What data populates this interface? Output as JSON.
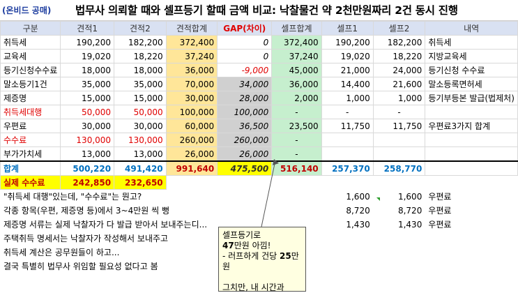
{
  "header": {
    "tag": "(온비드 공매)",
    "title": "법무사 의뢰할 때와 셀프등기 할때 금액 비교: 낙찰물건 약 2천만원짜리 2건 동시 진행"
  },
  "columns": [
    "구분",
    "견적1",
    "견적2",
    "견적합계",
    "GAP(차이)",
    "셀프합계",
    "셀프1",
    "셀프2",
    "내역"
  ],
  "rows": [
    {
      "label": "취득세",
      "e1": "190,200",
      "e2": "182,200",
      "esum": "372,400",
      "gap": "0",
      "ssum": "372,400",
      "s1": "190,200",
      "s2": "182,200",
      "memo": "취득세"
    },
    {
      "label": "교육세",
      "e1": "19,020",
      "e2": "18,220",
      "esum": "37,240",
      "gap": "0",
      "ssum": "37,240",
      "s1": "19,020",
      "s2": "18,220",
      "memo": "지방교육세"
    },
    {
      "label": "등기신청수수료",
      "e1": "18,000",
      "e2": "18,000",
      "esum": "36,000",
      "gap": "-9,000",
      "ssum": "45,000",
      "s1": "21,000",
      "s2": "24,000",
      "memo": "등기신청 수수료"
    },
    {
      "label": "말소등기1건",
      "e1": "35,000",
      "e2": "35,000",
      "esum": "70,000",
      "gap": "34,000",
      "ssum": "36,000",
      "s1": "14,400",
      "s2": "21,600",
      "memo": "말소등록면허세"
    },
    {
      "label": "제증명",
      "e1": "15,000",
      "e2": "15,000",
      "esum": "30,000",
      "gap": "28,000",
      "ssum": "2,000",
      "s1": "1,000",
      "s2": "1,000",
      "memo": "등기부등본 발급(법제처)"
    },
    {
      "label": "취득세대행",
      "e1": "50,000",
      "e2": "50,000",
      "esum": "100,000",
      "gap": "100,000",
      "ssum": "-",
      "s1": "-",
      "s2": "-",
      "memo": ""
    },
    {
      "label": "우편료",
      "e1": "30,000",
      "e2": "30,000",
      "esum": "60,000",
      "gap": "36,500",
      "ssum": "23,500",
      "s1": "11,750",
      "s2": "11,750",
      "memo": "우편료3가지 합계"
    },
    {
      "label": "수수료",
      "e1": "130,000",
      "e2": "130,000",
      "esum": "260,000",
      "gap": "260,000",
      "ssum": "-",
      "s1": "",
      "s2": "",
      "memo": ""
    },
    {
      "label": "부가가치세",
      "e1": "13,000",
      "e2": "13,000",
      "esum": "26,000",
      "gap": "26,000",
      "ssum": "-",
      "s1": "",
      "s2": "",
      "memo": ""
    }
  ],
  "total": {
    "label": "합계",
    "e1": "500,220",
    "e2": "491,420",
    "esum": "991,640",
    "gap": "475,500",
    "ssum": "516,140",
    "s1": "257,370",
    "s2": "258,770"
  },
  "actual": {
    "label": "실제 수수료",
    "e1": "242,850",
    "e2": "232,650"
  },
  "notes": [
    {
      "text": "\"취득세 대행\"있는데, \"수수료\"는 뭔고?",
      "s1": "1,600",
      "s2": "1,600",
      "memo": "우편료"
    },
    {
      "text": "각종 항목(우편, 제증명 등)에서 3~4만원 씩 뻥",
      "s1": "8,720",
      "s2": "8,720",
      "memo": "우편료"
    },
    {
      "text": "제증명 서류는 실제 낙찰자가 다 발급 받아서 보내주는디...",
      "s1": "1,430",
      "s2": "1,430",
      "memo": "우편료"
    },
    {
      "text": "주택취득 명세서는 낙찰자가 작성해서 보내주고",
      "s1": "",
      "s2": "",
      "memo": ""
    },
    {
      "text": "취득세 계산은 공무원들이 하고...",
      "s1": "",
      "s2": "",
      "memo": ""
    },
    {
      "text": "결국 특별히 법무사 위임할 필요성 없다고 봄",
      "s1": "",
      "s2": "",
      "memo": ""
    }
  ],
  "comment": {
    "line1": "셀프등기로",
    "line2_bold": "47",
    "line2_rest": "만원 아낌!",
    "line3_pre": " - 러프하게 건당 ",
    "line3_bold": "25",
    "line3_post": "만원",
    "line4": "",
    "line5": "그치만, 내 시간과"
  }
}
